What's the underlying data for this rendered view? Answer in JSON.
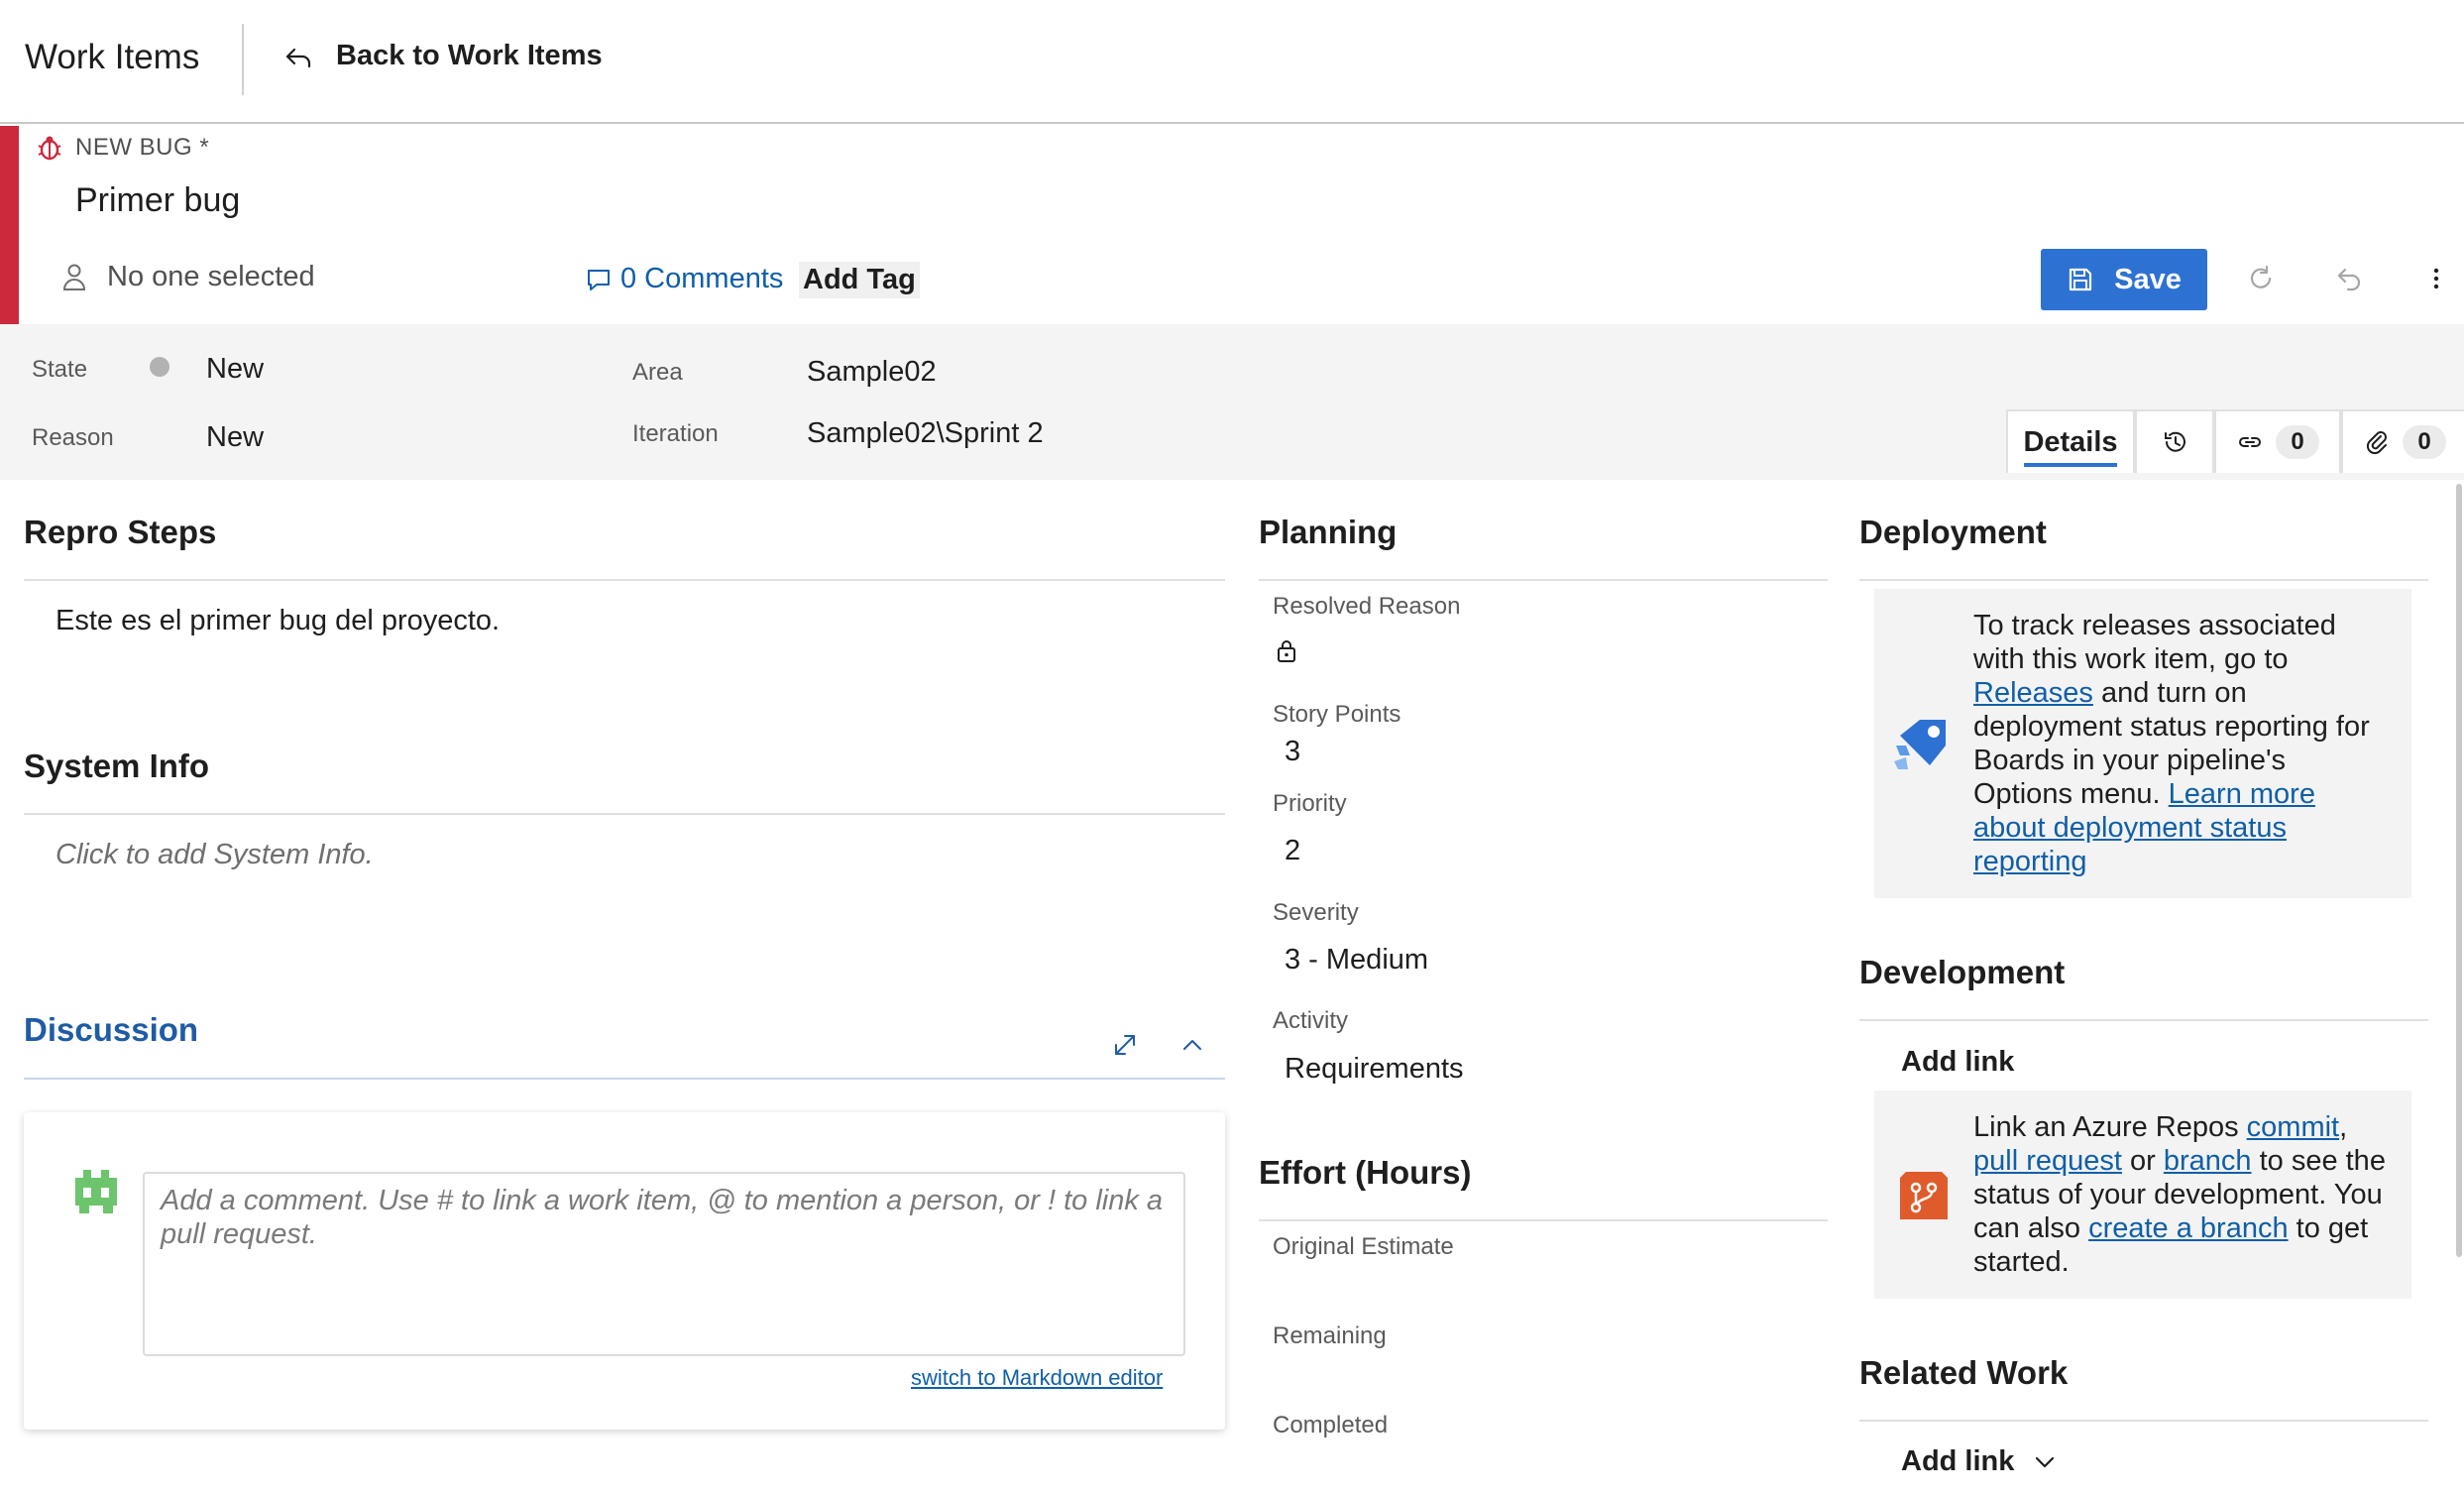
{
  "topbar": {
    "title": "Work Items",
    "back_label": "Back to Work Items"
  },
  "workitem": {
    "type_label": "NEW BUG *",
    "title": "Primer bug",
    "assignee": "No one selected",
    "comments_label": "0 Comments",
    "add_tag_label": "Add Tag",
    "save_label": "Save"
  },
  "fields": {
    "state_label": "State",
    "state_value": "New",
    "reason_label": "Reason",
    "reason_value": "New",
    "area_label": "Area",
    "area_value": "Sample02",
    "iteration_label": "Iteration",
    "iteration_value": "Sample02\\Sprint 2"
  },
  "tabs": {
    "details": "Details",
    "links_count": "0",
    "attachments_count": "0"
  },
  "repro": {
    "title": "Repro Steps",
    "text": "Este es el primer bug del proyecto."
  },
  "system_info": {
    "title": "System Info",
    "placeholder": "Click to add System Info."
  },
  "discussion": {
    "title": "Discussion",
    "placeholder": "Add a comment. Use # to link a work item, @ to mention a person, or ! to link a pull request.",
    "markdown_link": "switch to Markdown editor"
  },
  "planning": {
    "title": "Planning",
    "resolved_reason_label": "Resolved Reason",
    "story_points_label": "Story Points",
    "story_points_value": "3",
    "priority_label": "Priority",
    "priority_value": "2",
    "severity_label": "Severity",
    "severity_value": "3 - Medium",
    "activity_label": "Activity",
    "activity_value": "Requirements"
  },
  "effort": {
    "title": "Effort (Hours)",
    "original_label": "Original Estimate",
    "remaining_label": "Remaining",
    "completed_label": "Completed"
  },
  "deployment": {
    "title": "Deployment",
    "text1": "To track releases associated with this work item, go to ",
    "releases_link": "Releases",
    "text2": " and turn on deployment status reporting for Boards in your pipeline's Options menu. ",
    "learn_more_link": "Learn more about deployment status reporting"
  },
  "development": {
    "title": "Development",
    "add_link_label": "Add link",
    "text1": "Link an Azure Repos ",
    "commit_link": "commit",
    "comma": ",",
    "pull_request_link": "pull request",
    "or_text": " or ",
    "branch_link": "branch",
    "text2": " to see the status of your development. You can also ",
    "create_branch_link": "create a branch",
    "text3": " to get started."
  },
  "related": {
    "title": "Related Work",
    "add_link_label": "Add link"
  },
  "colors": {
    "bug_red": "#cc293d",
    "primary_blue": "#2d72d2",
    "link_blue": "#0f5fa8",
    "field_bg": "#f4f4f4"
  }
}
